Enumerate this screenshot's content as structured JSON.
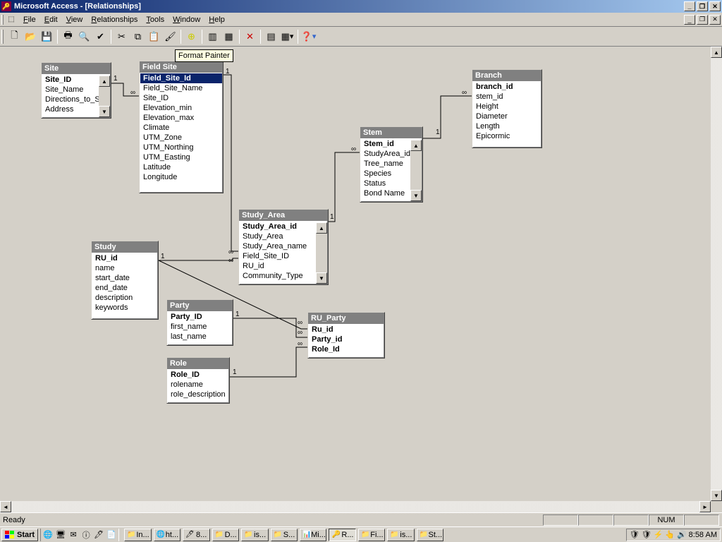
{
  "title": "Microsoft Access - [Relationships]",
  "menus": {
    "file": "File",
    "edit": "Edit",
    "view": "View",
    "rel": "Relationships",
    "tools": "Tools",
    "window": "Window",
    "help": "Help"
  },
  "tooltip": "Format Painter",
  "tables": {
    "site": {
      "title": "Site",
      "fields": [
        "Site_ID",
        "Site_Name",
        "Directions_to_Si",
        "Address"
      ],
      "pk": [
        0
      ]
    },
    "fieldsite": {
      "title": "Field Site",
      "fields": [
        "Field_Site_Id",
        "Field_Site_Name",
        "Site_ID",
        "Elevation_min",
        "Elevation_max",
        "Climate",
        "UTM_Zone",
        "UTM_Northing",
        "UTM_Easting",
        "Latitude",
        "Longitude"
      ],
      "pk": [
        0
      ],
      "sel": 0
    },
    "studyarea": {
      "title": "Study_Area",
      "fields": [
        "Study_Area_id",
        "Study_Area",
        "Study_Area_name",
        "Field_Site_ID",
        "RU_id",
        "Community_Type"
      ],
      "pk": [
        0
      ]
    },
    "stem": {
      "title": "Stem",
      "fields": [
        "Stem_id",
        "StudyArea_id",
        "Tree_name",
        "Species",
        "Status",
        "Bond Name"
      ],
      "pk": [
        0
      ]
    },
    "branch": {
      "title": "Branch",
      "fields": [
        "branch_id",
        "stem_id",
        "Height",
        "Diameter",
        "Length",
        "Epicormic"
      ],
      "pk": [
        0
      ]
    },
    "study": {
      "title": "Study",
      "fields": [
        "RU_id",
        "name",
        "start_date",
        "end_date",
        "description",
        "keywords"
      ],
      "pk": [
        0
      ]
    },
    "party": {
      "title": "Party",
      "fields": [
        "Party_ID",
        "first_name",
        "last_name"
      ],
      "pk": [
        0
      ]
    },
    "role": {
      "title": "Role",
      "fields": [
        "Role_ID",
        "rolename",
        "role_description"
      ],
      "pk": [
        0
      ]
    },
    "ruparty": {
      "title": "RU_Party",
      "fields": [
        "Ru_id",
        "Party_id",
        "Role_Id"
      ],
      "pk": [
        0,
        1,
        2
      ]
    }
  },
  "status": {
    "ready": "Ready",
    "num": "NUM"
  },
  "taskbar": {
    "start": "Start",
    "tasks": [
      "In...",
      "ht...",
      "8...",
      "D...",
      "is...",
      "S...",
      "Mi...",
      "R...",
      "Fi...",
      "is...",
      "St..."
    ],
    "active": 7,
    "time": "8:58 AM"
  }
}
